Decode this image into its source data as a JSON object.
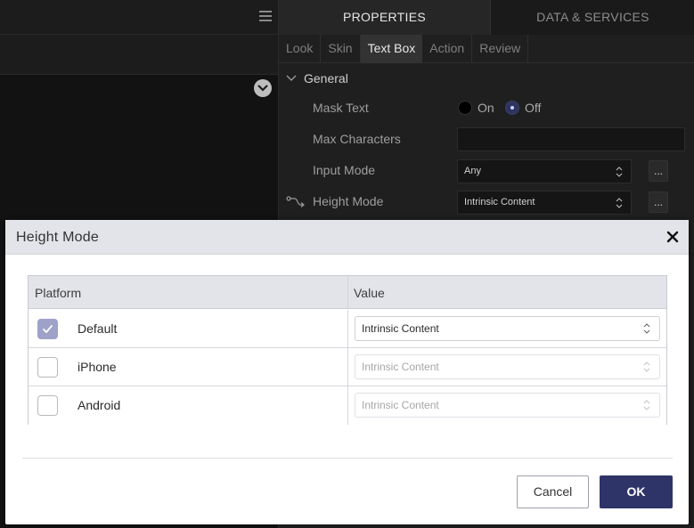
{
  "properties_panel": {
    "tabs": [
      "PROPERTIES",
      "DATA & SERVICES"
    ],
    "sub_tabs": [
      "Look",
      "Skin",
      "Text Box",
      "Action",
      "Review"
    ],
    "active_sub_tab": "Text Box",
    "section": "General",
    "mask_text": {
      "label": "Mask Text",
      "on_label": "On",
      "off_label": "Off",
      "selected": "Off"
    },
    "max_characters": {
      "label": "Max Characters",
      "value": ""
    },
    "input_mode": {
      "label": "Input Mode",
      "value": "Any",
      "more": "..."
    },
    "height_mode": {
      "label": "Height Mode",
      "value": "Intrinsic Content",
      "more": "..."
    }
  },
  "dialog": {
    "title": "Height Mode",
    "columns": {
      "platform": "Platform",
      "value": "Value"
    },
    "rows": [
      {
        "platform": "Default",
        "checked": true,
        "value": "Intrinsic Content",
        "enabled": true
      },
      {
        "platform": "iPhone",
        "checked": false,
        "value": "Intrinsic Content",
        "enabled": false
      },
      {
        "platform": "Android",
        "checked": false,
        "value": "Intrinsic Content",
        "enabled": false
      }
    ],
    "cancel_label": "Cancel",
    "ok_label": "OK"
  },
  "colors": {
    "primary": "#2e3467",
    "checkbox_checked": "#9ea2c9",
    "panel_bg": "#1f1f1f"
  },
  "icons": [
    "menu-icon",
    "chevron-down-icon",
    "close-icon",
    "check-icon",
    "select-arrows-icon",
    "link-icon"
  ]
}
